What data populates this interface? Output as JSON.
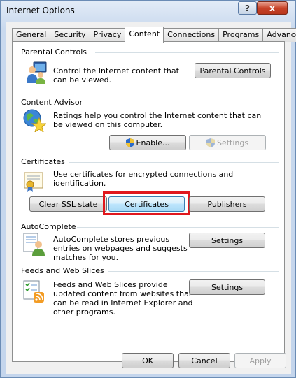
{
  "window": {
    "title": "Internet Options",
    "help_label": "?",
    "close_label": "x"
  },
  "tabs": [
    {
      "label": "General",
      "active": false
    },
    {
      "label": "Security",
      "active": false
    },
    {
      "label": "Privacy",
      "active": false
    },
    {
      "label": "Content",
      "active": true
    },
    {
      "label": "Connections",
      "active": false
    },
    {
      "label": "Programs",
      "active": false
    },
    {
      "label": "Advanced",
      "active": false
    }
  ],
  "parental": {
    "title": "Parental Controls",
    "desc": "Control the Internet content that can be viewed.",
    "button": "Parental Controls"
  },
  "advisor": {
    "title": "Content Advisor",
    "desc": "Ratings help you control the Internet content that can be viewed on this computer.",
    "enable_button": "Enable...",
    "settings_button": "Settings"
  },
  "certificates": {
    "title": "Certificates",
    "desc": "Use certificates for encrypted connections and identification.",
    "clear_ssl_button": "Clear SSL state",
    "certificates_button": "Certificates",
    "publishers_button": "Publishers"
  },
  "autocomplete": {
    "title": "AutoComplete",
    "desc": "AutoComplete stores previous entries on webpages and suggests matches for you.",
    "settings_button": "Settings"
  },
  "feeds": {
    "title": "Feeds and Web Slices",
    "desc": "Feeds and Web Slices provide updated content from websites that can be read in Internet Explorer and other programs.",
    "settings_button": "Settings"
  },
  "footer": {
    "ok": "OK",
    "cancel": "Cancel",
    "apply": "Apply"
  },
  "colors": {
    "highlight": "#e0171d",
    "close_button": "#c8442a",
    "panel": "#ffffff"
  },
  "icons": [
    "parental-controls-icon",
    "content-advisor-icon",
    "certificate-icon",
    "autocomplete-icon",
    "feeds-icon",
    "uac-shield-icon"
  ]
}
